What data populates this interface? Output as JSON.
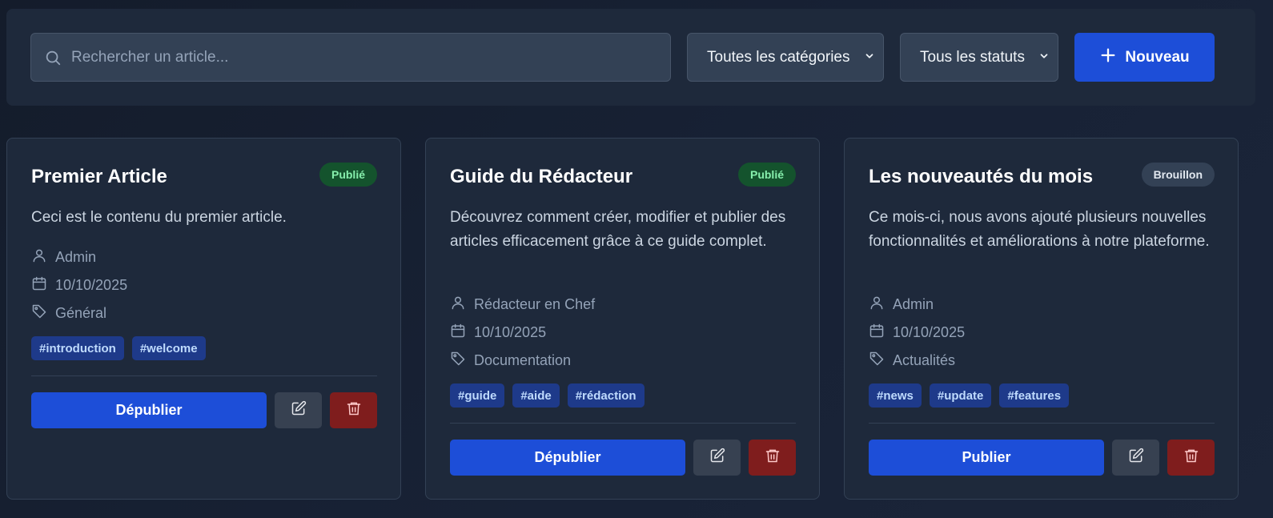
{
  "toolbar": {
    "search_placeholder": "Rechercher un article...",
    "category_select": "Toutes les catégories",
    "status_select": "Tous les statuts",
    "new_button": "Nouveau"
  },
  "colors": {
    "primary": "#1d4ed8",
    "published_badge": "#14532d",
    "draft_badge": "#334155",
    "delete": "#7f1d1d",
    "tag": "#1e3a8a"
  },
  "icons": {
    "search": "search-icon",
    "chevron": "chevron-down-icon",
    "plus": "plus-icon",
    "author": "user-icon",
    "date": "calendar-icon",
    "category": "tag-icon",
    "edit": "edit-icon",
    "delete": "trash-icon"
  },
  "articles": [
    {
      "title": "Premier Article",
      "status": "Publié",
      "content": "Ceci est le contenu du premier article.",
      "author": "Admin",
      "date": "10/10/2025",
      "category": "Général",
      "tags": [
        "#introduction",
        "#welcome"
      ],
      "action": "Dépublier"
    },
    {
      "title": "Guide du Rédacteur",
      "status": "Publié",
      "content": "Découvrez comment créer, modifier et publier des articles efficacement grâce à ce guide complet.",
      "author": "Rédacteur en Chef",
      "date": "10/10/2025",
      "category": "Documentation",
      "tags": [
        "#guide",
        "#aide",
        "#rédaction"
      ],
      "action": "Dépublier"
    },
    {
      "title": "Les nouveautés du mois",
      "status": "Brouillon",
      "content": "Ce mois-ci, nous avons ajouté plusieurs nouvelles fonctionnalités et améliorations à notre plateforme.",
      "author": "Admin",
      "date": "10/10/2025",
      "category": "Actualités",
      "tags": [
        "#news",
        "#update",
        "#features"
      ],
      "action": "Publier"
    }
  ]
}
